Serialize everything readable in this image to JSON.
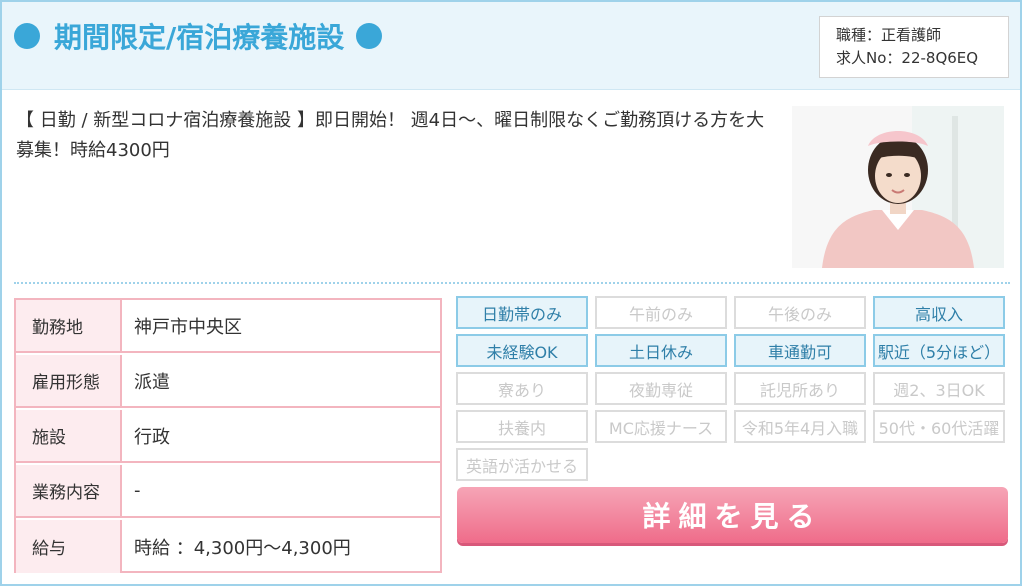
{
  "header": {
    "title": "期間限定/宿泊療養施設",
    "job_type": "職種：正看護師",
    "job_no": "求人No：22-8Q6EQ"
  },
  "description": "【 日勤 / 新型コロナ宿泊療養施設 】即日開始！ 週4日〜、曜日制限なくご勤務頂ける方を大募集！時給4300円",
  "photo_icon": "nurse-photo",
  "info": {
    "rows": [
      {
        "label": "勤務地",
        "value": "神戸市中央区"
      },
      {
        "label": "雇用形態",
        "value": "派遣"
      },
      {
        "label": "施設",
        "value": "行政"
      },
      {
        "label": "業務内容",
        "value": "-"
      },
      {
        "label": "給与",
        "value": "時給 ：4,300円〜4,300円"
      }
    ]
  },
  "tags": [
    {
      "label": "日勤帯のみ",
      "active": true
    },
    {
      "label": "午前のみ",
      "active": false
    },
    {
      "label": "午後のみ",
      "active": false
    },
    {
      "label": "高収入",
      "active": true
    },
    {
      "label": "未経験OK",
      "active": true
    },
    {
      "label": "土日休み",
      "active": true
    },
    {
      "label": "車通勤可",
      "active": true
    },
    {
      "label": "駅近（5分ほど）",
      "active": true
    },
    {
      "label": "寮あり",
      "active": false
    },
    {
      "label": "夜勤専従",
      "active": false
    },
    {
      "label": "託児所あり",
      "active": false
    },
    {
      "label": "週2、3日OK",
      "active": false
    },
    {
      "label": "扶養内",
      "active": false
    },
    {
      "label": "MC応援ナース",
      "active": false
    },
    {
      "label": "令和5年4月入職",
      "active": false
    },
    {
      "label": "50代・60代活躍",
      "active": false
    },
    {
      "label": "英語が活かせる",
      "active": false
    }
  ],
  "detail_button": "詳細を見る",
  "colors": {
    "accent_blue": "#3aa7d8",
    "tag_border_on": "#8ccbe7",
    "table_border_pink": "#f3b5bf",
    "button_pink": "#ef6c8a"
  }
}
